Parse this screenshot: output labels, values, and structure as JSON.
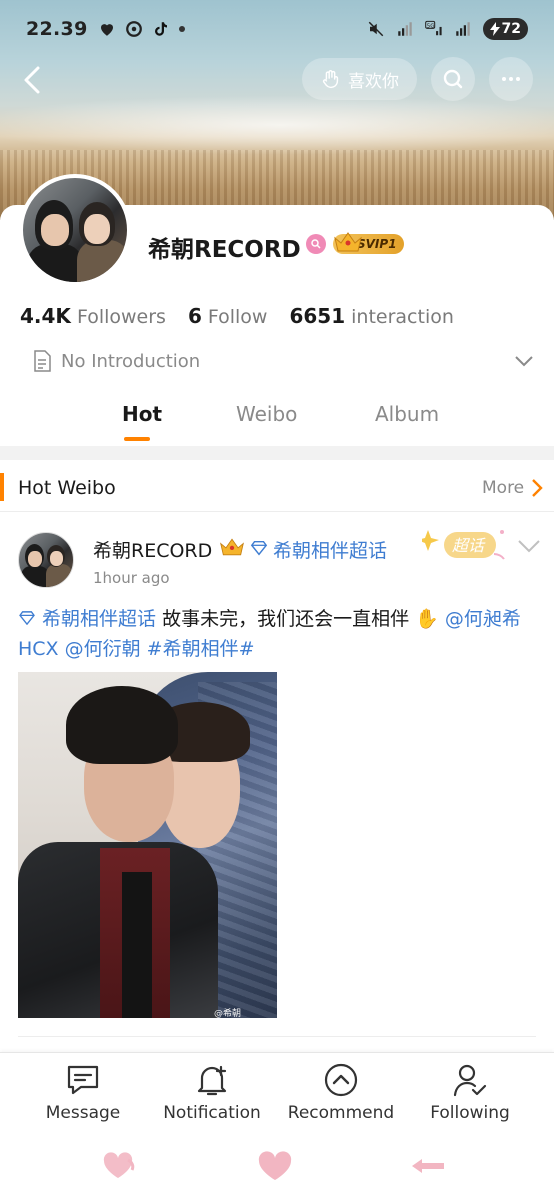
{
  "status_bar": {
    "time": "22.39",
    "battery": "72"
  },
  "header": {
    "like_button_label": "喜欢你"
  },
  "profile": {
    "name": "希朝RECORD",
    "svip_label": "SVIP1",
    "stats": [
      {
        "value": "4.4K",
        "label": "Followers"
      },
      {
        "value": "6",
        "label": "Follow"
      },
      {
        "value": "6651",
        "label": "interaction"
      }
    ],
    "introduction": "No Introduction"
  },
  "tabs": [
    {
      "label": "Hot",
      "active": true
    },
    {
      "label": "Weibo",
      "active": false
    },
    {
      "label": "Album",
      "active": false
    }
  ],
  "section": {
    "title": "Hot Weibo",
    "more_label": "More"
  },
  "post": {
    "author": "希朝RECORD",
    "topic": "希朝相伴超话",
    "chaohua_badge": "超话",
    "time": "1hour ago",
    "text_topic": "希朝相伴超话",
    "text_body": " 故事未完，我们还会一直相伴 ",
    "text_emoji": "✋",
    "mention_1": " @何昶希HCX",
    "mention_2": " @何衍朝",
    "hashtag": "  #希朝相伴#",
    "photo_watermark": "@希朝RECORD"
  },
  "bottom_nav": [
    {
      "label": "Message",
      "icon": "message-icon"
    },
    {
      "label": "Notification",
      "icon": "bell-plus-icon"
    },
    {
      "label": "Recommend",
      "icon": "chevron-up-circle-icon"
    },
    {
      "label": "Following",
      "icon": "user-check-icon"
    }
  ],
  "colors": {
    "accent": "#ff8200",
    "link": "#3f7dd1",
    "badge_pink": "#f08ab6",
    "svip_gold": "#e3a12a",
    "system_nav": "#f2b6c2"
  }
}
